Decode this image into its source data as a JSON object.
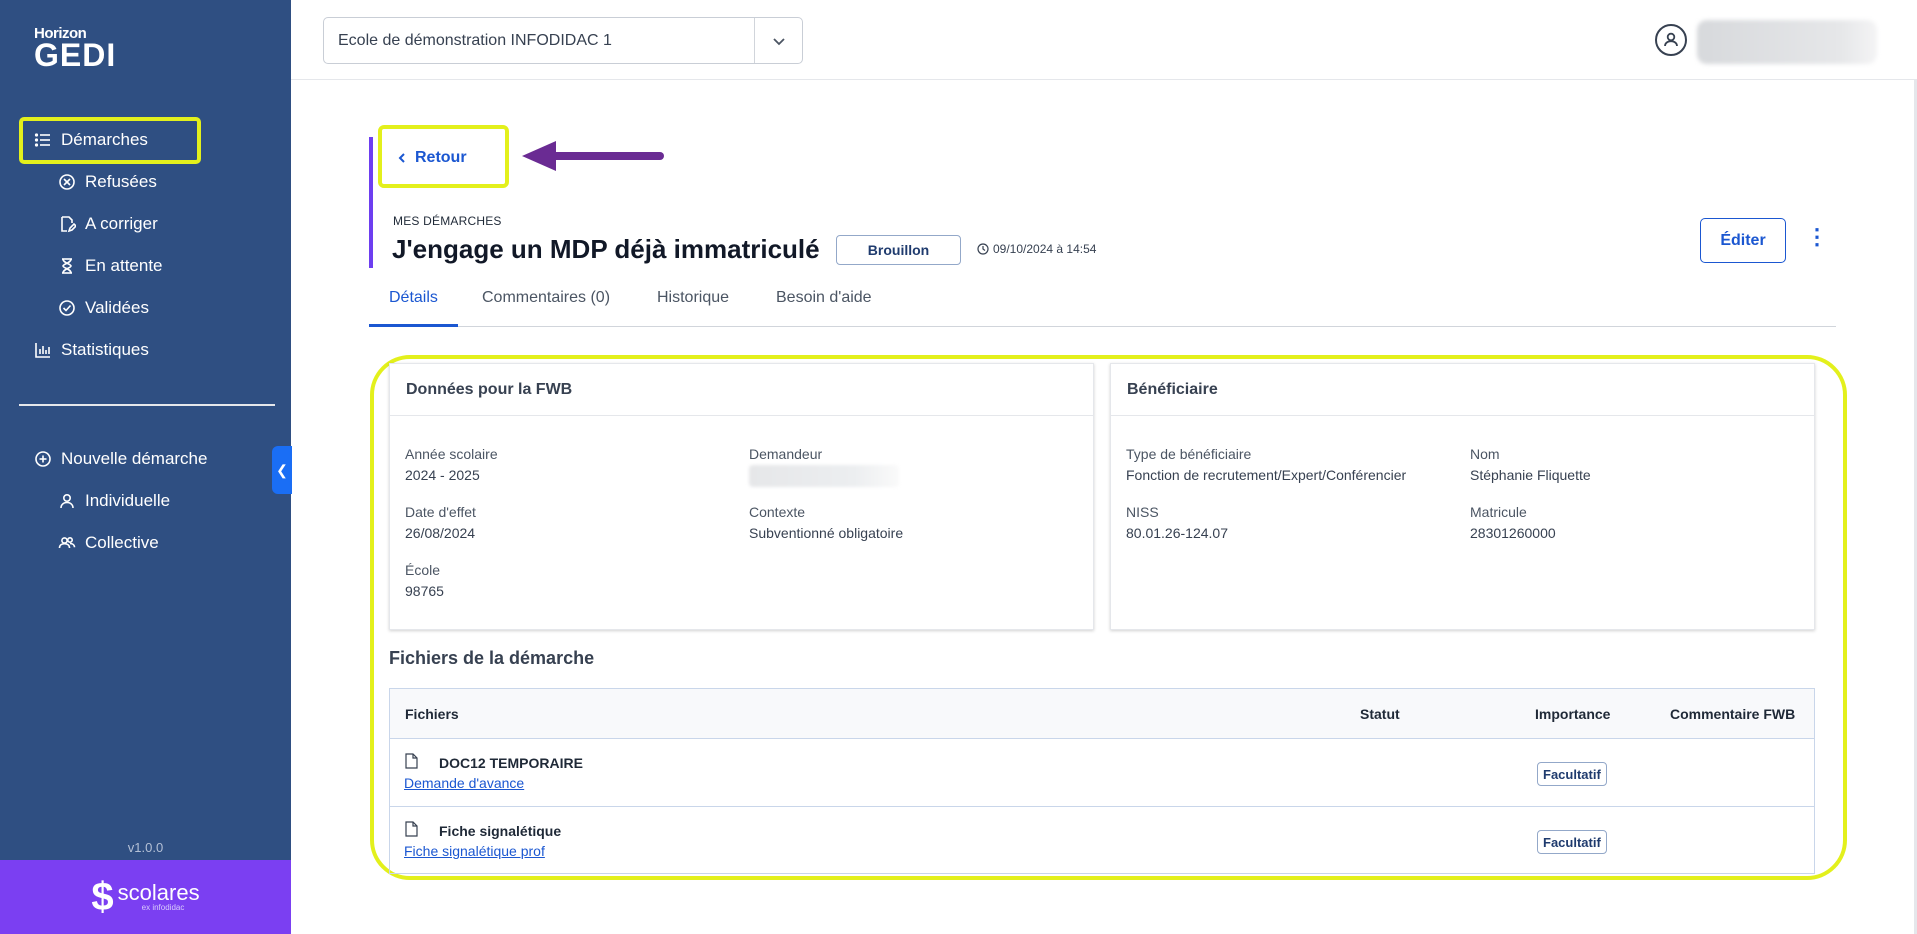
{
  "sidebar": {
    "logo_top": "Horizon",
    "logo_main": "GEDI",
    "items": [
      {
        "label": "Démarches",
        "icon": "list-icon"
      },
      {
        "label": "Refusées",
        "icon": "x-circle-icon"
      },
      {
        "label": "A corriger",
        "icon": "edit-doc-icon"
      },
      {
        "label": "En attente",
        "icon": "hourglass-icon"
      },
      {
        "label": "Validées",
        "icon": "check-circle-icon"
      },
      {
        "label": "Statistiques",
        "icon": "bar-chart-icon"
      },
      {
        "label": "Nouvelle démarche",
        "icon": "plus-circle-icon"
      },
      {
        "label": "Individuelle",
        "icon": "user-icon"
      },
      {
        "label": "Collective",
        "icon": "users-icon"
      }
    ],
    "version": "v1.0.0",
    "brand_word": "scolares",
    "brand_sub": "ex infodidac"
  },
  "topbar": {
    "school_select": "Ecole de démonstration INFODIDAC 1"
  },
  "header": {
    "back_label": "Retour",
    "kicker": "MES DÉMARCHES",
    "title": "J'engage un MDP déjà immatriculé",
    "status_badge": "Brouillon",
    "timestamp": "09/10/2024 à 14:54",
    "edit_label": "Éditer"
  },
  "tabs": [
    "Détails",
    "Commentaires (0)",
    "Historique",
    "Besoin d'aide"
  ],
  "fwb_card": {
    "title": "Données pour la FWB",
    "fields": [
      {
        "label": "Année scolaire",
        "value": "2024 - 2025"
      },
      {
        "label": "Demandeur",
        "value": ""
      },
      {
        "label": "Date d'effet",
        "value": "26/08/2024"
      },
      {
        "label": "Contexte",
        "value": "Subventionné obligatoire"
      },
      {
        "label": "École",
        "value": "98765"
      }
    ]
  },
  "beneficiary_card": {
    "title": "Bénéficiaire",
    "fields": [
      {
        "label": "Type de bénéficiaire",
        "value": "Fonction de recrutement/Expert/Conférencier"
      },
      {
        "label": "Nom",
        "value": "Stéphanie Fliquette"
      },
      {
        "label": "NISS",
        "value": "80.01.26-124.07"
      },
      {
        "label": "Matricule",
        "value": "28301260000"
      }
    ]
  },
  "files": {
    "title": "Fichiers de la démarche",
    "columns": [
      "Fichiers",
      "Statut",
      "Importance",
      "Commentaire FWB"
    ],
    "rows": [
      {
        "name": "DOC12 TEMPORAIRE",
        "link": "Demande d'avance",
        "importance": "Facultatif"
      },
      {
        "name": "Fiche signalétique",
        "link": "Fiche signalétique prof",
        "importance": "Facultatif"
      }
    ]
  },
  "colors": {
    "sidebar_bg": "#2f4f82",
    "accent_blue": "#1b57d1",
    "highlight_yellow": "#e3f01c",
    "brand_purple": "#7b3ff2",
    "arrow_purple": "#6a2b93"
  }
}
